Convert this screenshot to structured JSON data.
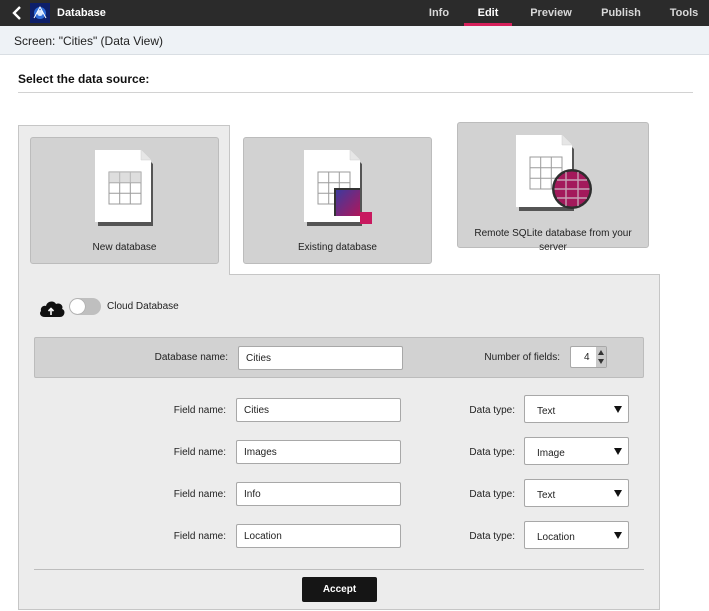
{
  "app": {
    "title": "Database"
  },
  "nav": [
    {
      "label": "Info",
      "active": false
    },
    {
      "label": "Edit",
      "active": true
    },
    {
      "label": "Preview",
      "active": false
    },
    {
      "label": "Publish",
      "active": false
    },
    {
      "label": "Tools",
      "active": false
    }
  ],
  "screen": {
    "title": "Screen: \"Cities\" (Data View)"
  },
  "section": {
    "title": "Select the data source:"
  },
  "sources": [
    {
      "label": "New database",
      "selected": true
    },
    {
      "label": "Existing database",
      "selected": false
    },
    {
      "label": "Remote SQLite database from your server",
      "selected": false
    }
  ],
  "cloud": {
    "label": "Cloud Database",
    "enabled": false
  },
  "database": {
    "name_label": "Database name:",
    "name_value": "Cities",
    "fields_label": "Number of fields:",
    "fields_value": "4"
  },
  "fields": [
    {
      "name_label": "Field name:",
      "name": "Cities",
      "type_label": "Data type:",
      "type": "Text"
    },
    {
      "name_label": "Field name:",
      "name": "Images",
      "type_label": "Data type:",
      "type": "Image"
    },
    {
      "name_label": "Field name:",
      "name": "Info",
      "type_label": "Data type:",
      "type": "Text"
    },
    {
      "name_label": "Field name:",
      "name": "Location",
      "type_label": "Data type:",
      "type": "Location"
    }
  ],
  "actions": {
    "accept": "Accept"
  },
  "colors": {
    "accent": "#d6205b",
    "topbar": "#2b2b2b",
    "button": "#151515"
  }
}
